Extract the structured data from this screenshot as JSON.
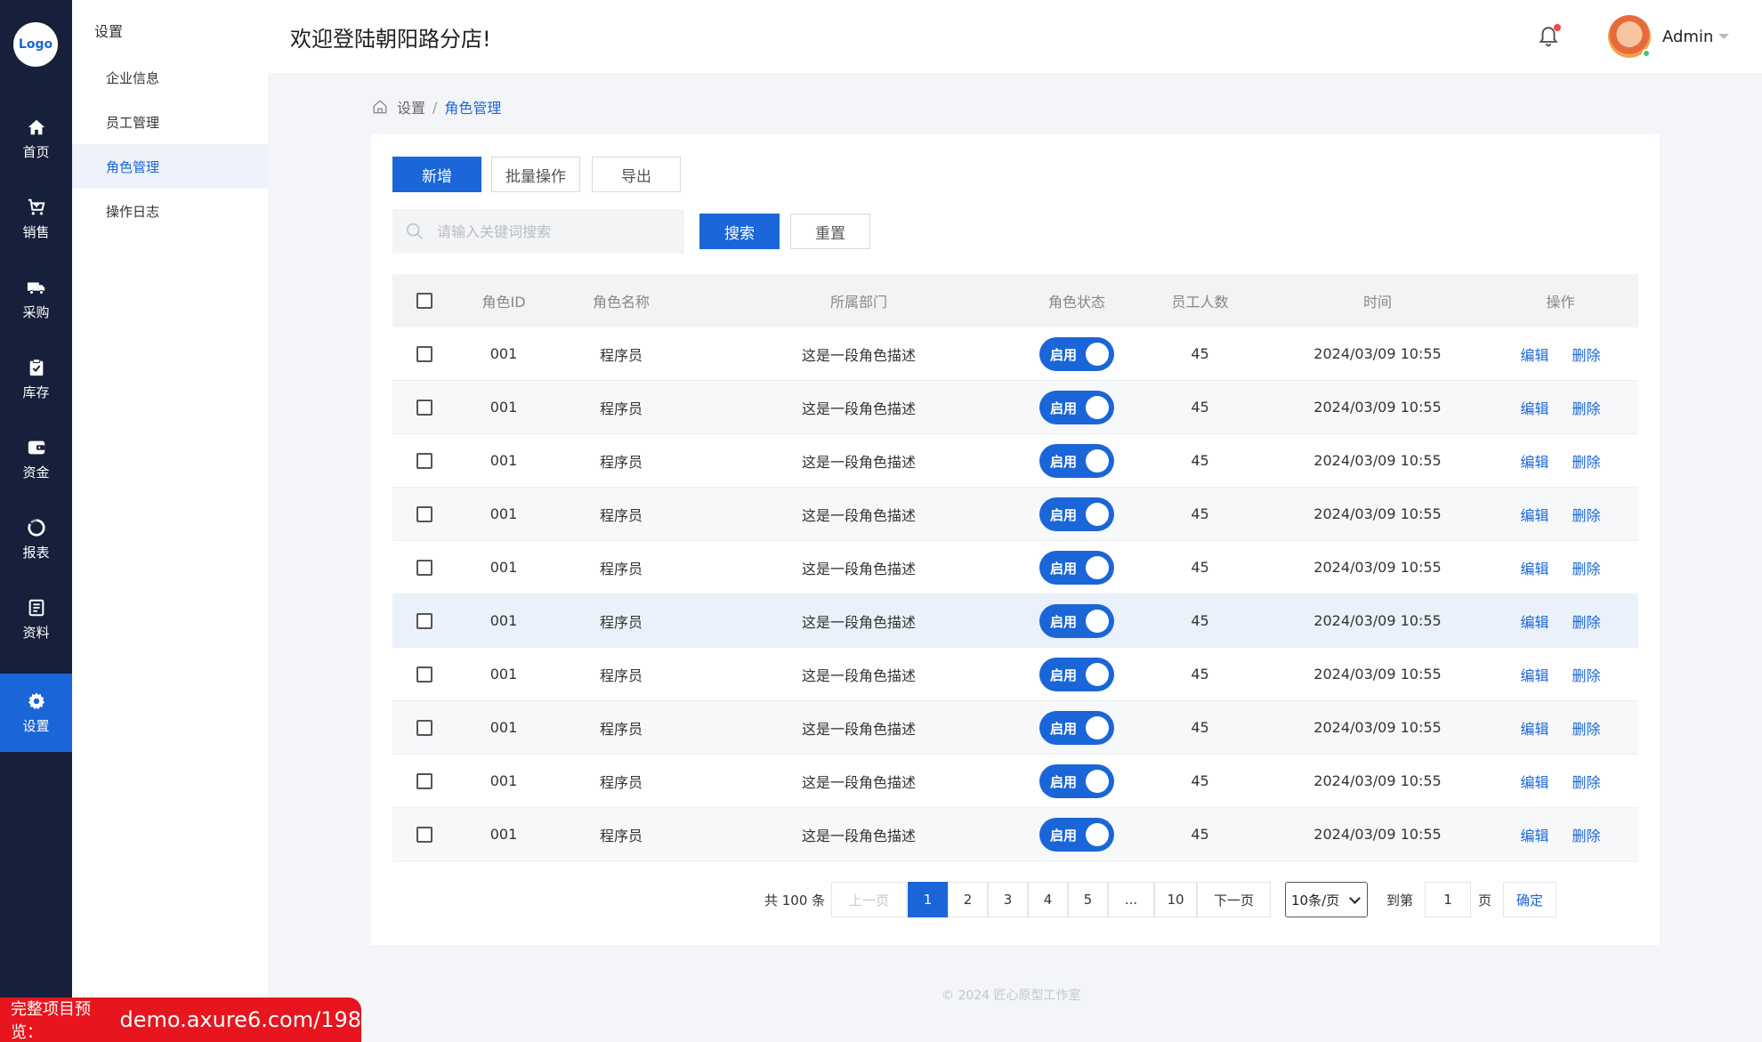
{
  "brand": {
    "logo_text": "Logo",
    "accent": "#1a66d8",
    "nav_bg": "#16203b"
  },
  "nav": {
    "items": [
      {
        "label": "首页",
        "icon": "home-icon"
      },
      {
        "label": "销售",
        "icon": "cart-icon"
      },
      {
        "label": "采购",
        "icon": "truck-icon"
      },
      {
        "label": "库存",
        "icon": "clipboard-check-icon"
      },
      {
        "label": "资金",
        "icon": "wallet-icon"
      },
      {
        "label": "报表",
        "icon": "ring-chart-icon"
      },
      {
        "label": "资料",
        "icon": "document-icon"
      },
      {
        "label": "设置",
        "icon": "gear-icon",
        "active": true
      }
    ]
  },
  "subnav": {
    "title": "设置",
    "items": [
      {
        "label": "企业信息"
      },
      {
        "label": "员工管理"
      },
      {
        "label": "角色管理",
        "active": true
      },
      {
        "label": "操作日志"
      }
    ]
  },
  "header": {
    "welcome": "欢迎登陆朝阳路分店!",
    "user_name": "Admin"
  },
  "breadcrumb": {
    "parent": "设置",
    "separator": "/",
    "current": "角色管理"
  },
  "toolbar": {
    "add_label": "新增",
    "batch_label": "批量操作",
    "export_label": "导出"
  },
  "search": {
    "placeholder": "请输入关键词搜索",
    "value": "",
    "search_label": "搜索",
    "reset_label": "重置"
  },
  "table": {
    "columns": [
      "角色ID",
      "角色名称",
      "所属部门",
      "角色状态",
      "员工人数",
      "时间",
      "操作"
    ],
    "rows": [
      {
        "id": "001",
        "name": "程序员",
        "dept": "这是一段角色描述",
        "status": "启用",
        "count": "45",
        "time": "2024/03/09 10:55"
      },
      {
        "id": "001",
        "name": "程序员",
        "dept": "这是一段角色描述",
        "status": "启用",
        "count": "45",
        "time": "2024/03/09 10:55"
      },
      {
        "id": "001",
        "name": "程序员",
        "dept": "这是一段角色描述",
        "status": "启用",
        "count": "45",
        "time": "2024/03/09 10:55"
      },
      {
        "id": "001",
        "name": "程序员",
        "dept": "这是一段角色描述",
        "status": "启用",
        "count": "45",
        "time": "2024/03/09 10:55"
      },
      {
        "id": "001",
        "name": "程序员",
        "dept": "这是一段角色描述",
        "status": "启用",
        "count": "45",
        "time": "2024/03/09 10:55"
      },
      {
        "id": "001",
        "name": "程序员",
        "dept": "这是一段角色描述",
        "status": "启用",
        "count": "45",
        "time": "2024/03/09 10:55"
      },
      {
        "id": "001",
        "name": "程序员",
        "dept": "这是一段角色描述",
        "status": "启用",
        "count": "45",
        "time": "2024/03/09 10:55"
      },
      {
        "id": "001",
        "name": "程序员",
        "dept": "这是一段角色描述",
        "status": "启用",
        "count": "45",
        "time": "2024/03/09 10:55"
      },
      {
        "id": "001",
        "name": "程序员",
        "dept": "这是一段角色描述",
        "status": "启用",
        "count": "45",
        "time": "2024/03/09 10:55"
      },
      {
        "id": "001",
        "name": "程序员",
        "dept": "这是一段角色描述",
        "status": "启用",
        "count": "45",
        "time": "2024/03/09 10:55"
      }
    ],
    "edit_label": "编辑",
    "delete_label": "删除"
  },
  "pagination": {
    "total_text": "共 100 条",
    "prev_label": "上一页",
    "next_label": "下一页",
    "pages": [
      "1",
      "2",
      "3",
      "4",
      "5",
      "...",
      "10"
    ],
    "current_page": "1",
    "page_size": "10条/页",
    "goto_label": "到第",
    "goto_value": "1",
    "page_unit": "页",
    "confirm_label": "确定"
  },
  "footer": {
    "copyright": "© 2024    匠心原型工作室"
  },
  "promo": {
    "prefix": "完整项目预览：",
    "url": "demo.axure6.com/198"
  }
}
